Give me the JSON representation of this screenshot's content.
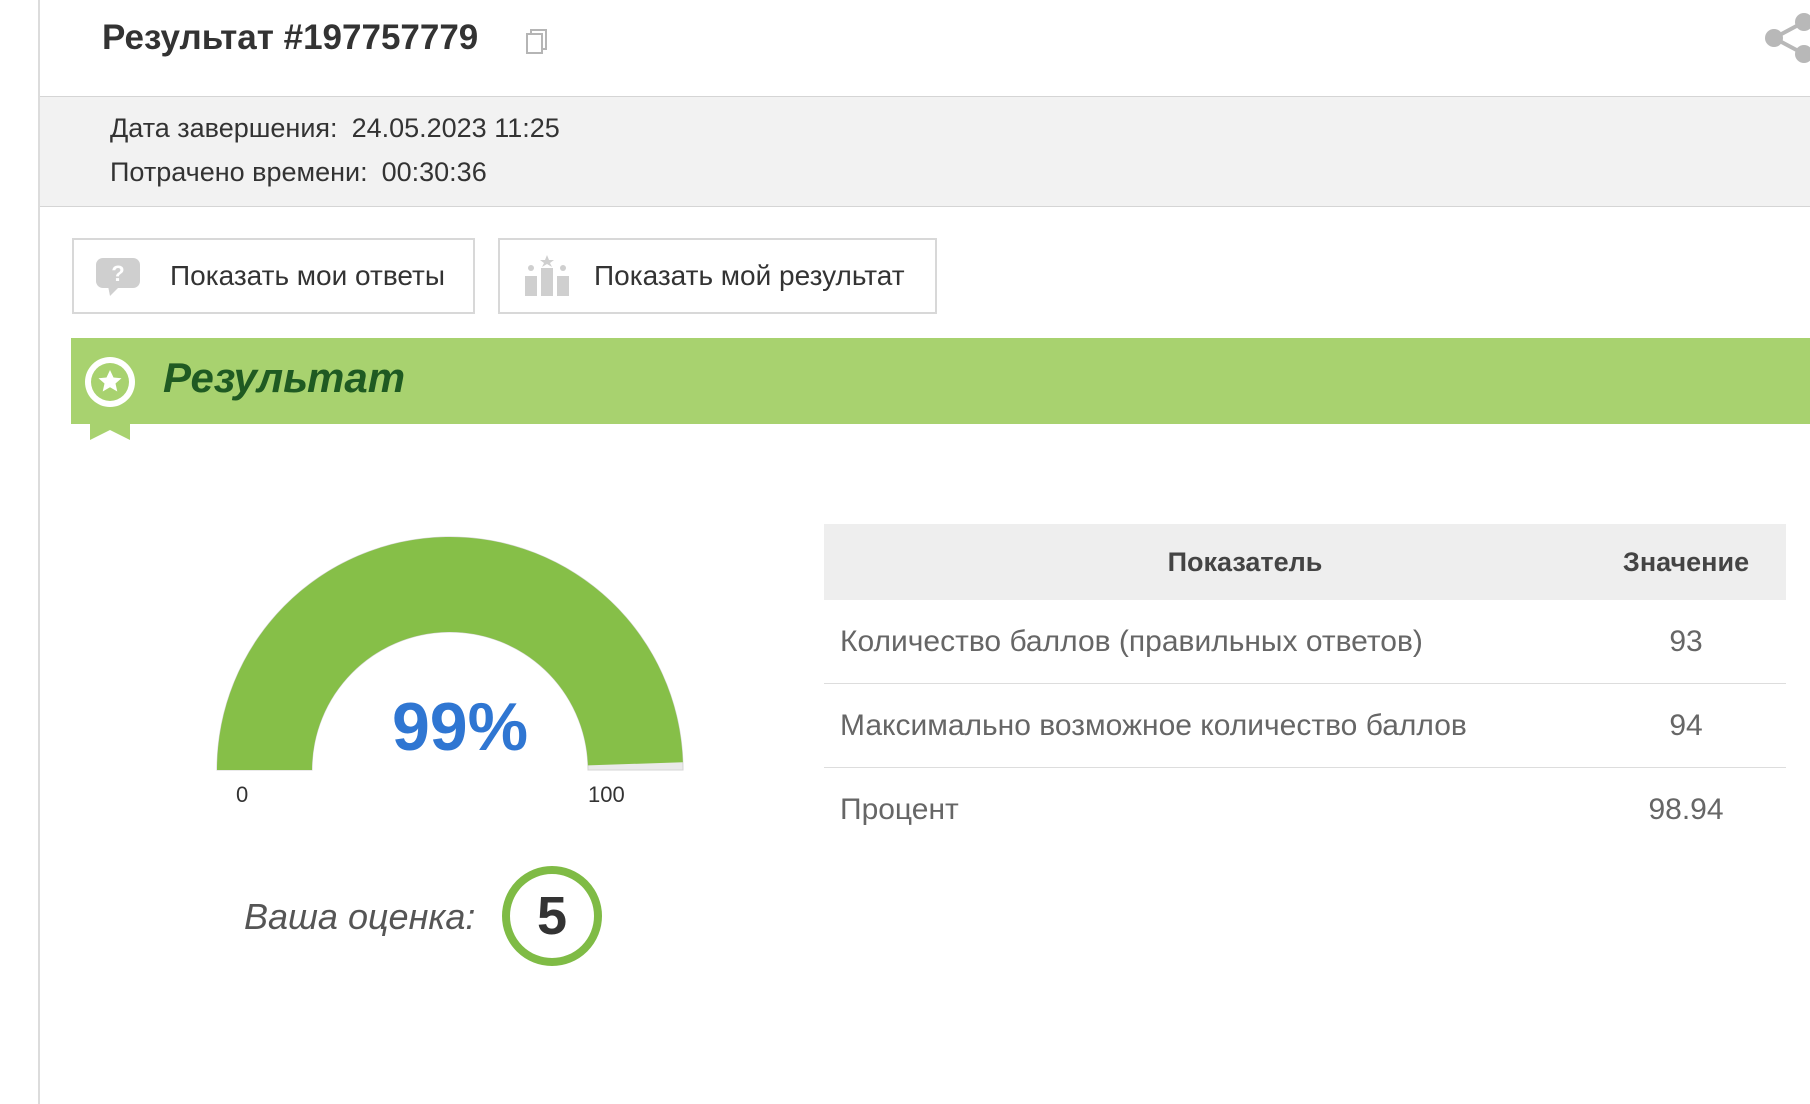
{
  "header": {
    "title": "Результат #197757779"
  },
  "info": {
    "completion_label": "Дата завершения:",
    "completion_value": "24.05.2023 11:25",
    "time_label": "Потрачено времени:",
    "time_value": "00:30:36"
  },
  "buttons": {
    "show_answers": "Показать мои ответы",
    "show_result": "Показать мой результат"
  },
  "result": {
    "banner_title": "Результат",
    "gauge": {
      "value_text": "99%",
      "percent": 98.94,
      "min": "0",
      "max": "100"
    },
    "grade_label": "Ваша оценка:",
    "grade": "5"
  },
  "colors": {
    "gauge_fill": "#86bf48",
    "banner": "#a8d26f",
    "banner_text": "#1f5a22",
    "gauge_value": "#2f76d2",
    "grade_ring": "#7fbb45"
  },
  "table": {
    "headers": [
      "Показатель",
      "Значение"
    ],
    "rows": [
      {
        "label": "Количество баллов (правильных ответов)",
        "value": "93"
      },
      {
        "label": "Максимально возможное количество баллов",
        "value": "94"
      },
      {
        "label": "Процент",
        "value": "98.94"
      }
    ]
  }
}
